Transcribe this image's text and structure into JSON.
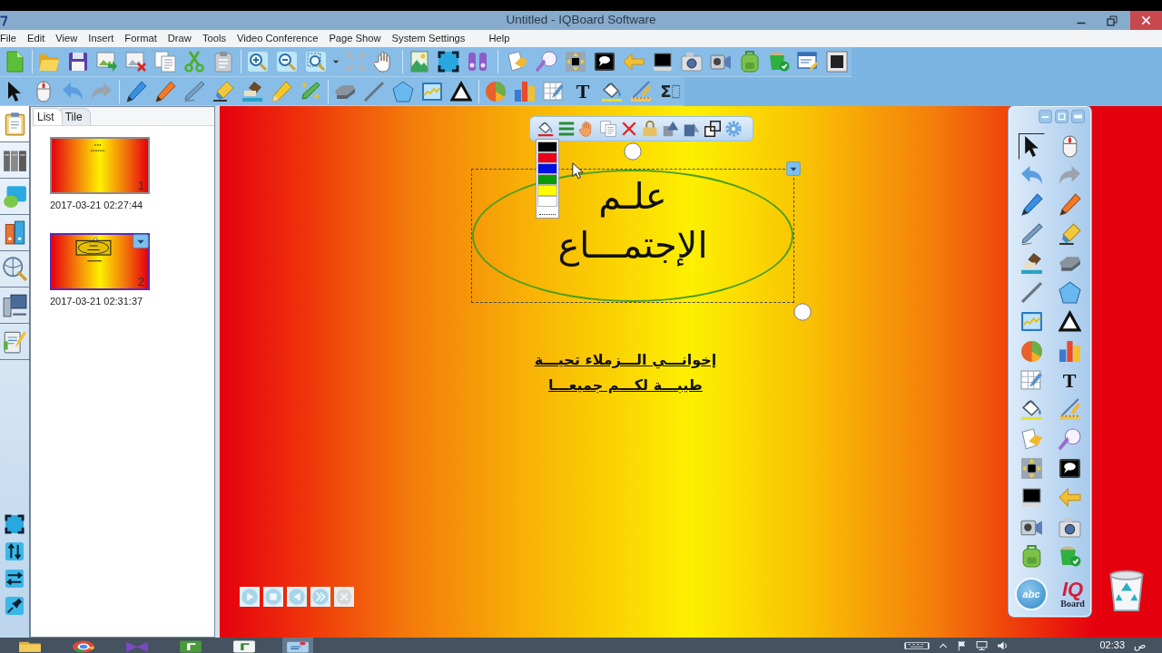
{
  "window": {
    "title": "Untitled - IQBoard Software"
  },
  "menu": [
    "File",
    "Edit",
    "View",
    "Insert",
    "Format",
    "Draw",
    "Tools",
    "Video Conference",
    "Page Show",
    "System Settings",
    "Help"
  ],
  "toolbar_2": {
    "text_tool": "T",
    "formula_tool": "Σ"
  },
  "dock": [
    {
      "selected": true
    },
    {
      "selected": false
    },
    {
      "selected": false
    },
    {
      "selected": false
    },
    {
      "selected": false
    },
    {
      "selected": false
    },
    {
      "selected": false
    }
  ],
  "page_panel": {
    "tabs": [
      {
        "label": "List",
        "selected": true
      },
      {
        "label": "Tile",
        "selected": false
      }
    ],
    "pages": [
      {
        "number": "1",
        "time": "2017-03-21 02:27:44",
        "selected": false
      },
      {
        "number": "2",
        "time": "2017-03-21 02:31:37",
        "selected": true
      }
    ]
  },
  "canvas": {
    "color_menu": [
      {
        "color": "#000000"
      },
      {
        "color": "#e8001c"
      },
      {
        "color": "#0010e0"
      },
      {
        "color": "#0a9a0a"
      },
      {
        "color": "#ffff00"
      },
      {
        "color": "#ffffff"
      }
    ],
    "shape_text": [
      "علـم",
      "الإجتمـــاع"
    ],
    "text_box": [
      "إخوانـــي الـــزملاء تحيـــة",
      "طيبـــة لكـــم جميعـــا"
    ]
  },
  "tool_panel": {
    "tools": [
      {
        "selected": true
      },
      {
        "selected": false
      },
      {
        "selected": false
      },
      {
        "selected": false
      },
      {
        "selected": false
      },
      {
        "selected": false
      },
      {
        "selected": false
      },
      {
        "selected": false
      },
      {
        "selected": false
      },
      {
        "selected": false
      },
      {
        "selected": false
      },
      {
        "selected": false
      },
      {
        "selected": false
      },
      {
        "selected": false
      },
      {
        "selected": false
      },
      {
        "selected": false
      },
      {
        "selected": false
      },
      {
        "label": "T",
        "selected": false
      },
      {
        "selected": false
      },
      {
        "selected": false
      },
      {
        "selected": false
      },
      {
        "selected": false
      },
      {
        "selected": false
      },
      {
        "selected": false
      },
      {
        "selected": false
      },
      {
        "selected": false
      },
      {
        "selected": false
      },
      {
        "selected": false
      },
      {
        "selected": false
      },
      {
        "selected": false
      }
    ],
    "badge": "abc",
    "logo": [
      "IQ",
      "Board"
    ]
  },
  "taskbar": {
    "time": "02:33",
    "period": "ص"
  }
}
